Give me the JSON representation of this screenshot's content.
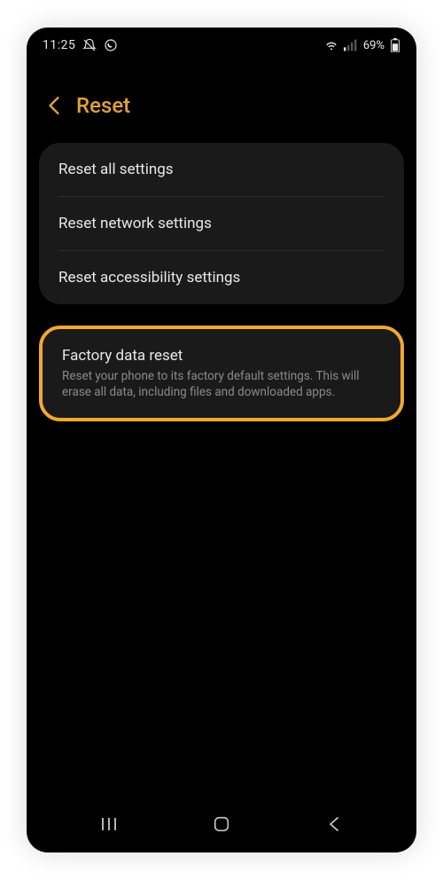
{
  "status": {
    "time": "11:25",
    "battery_text": "69%"
  },
  "header": {
    "title": "Reset"
  },
  "group1": {
    "items": [
      {
        "label": "Reset all settings"
      },
      {
        "label": "Reset network settings"
      },
      {
        "label": "Reset accessibility settings"
      }
    ]
  },
  "group2": {
    "title": "Factory data reset",
    "description": "Reset your phone to its factory default settings. This will erase all data, including files and downloaded apps."
  }
}
